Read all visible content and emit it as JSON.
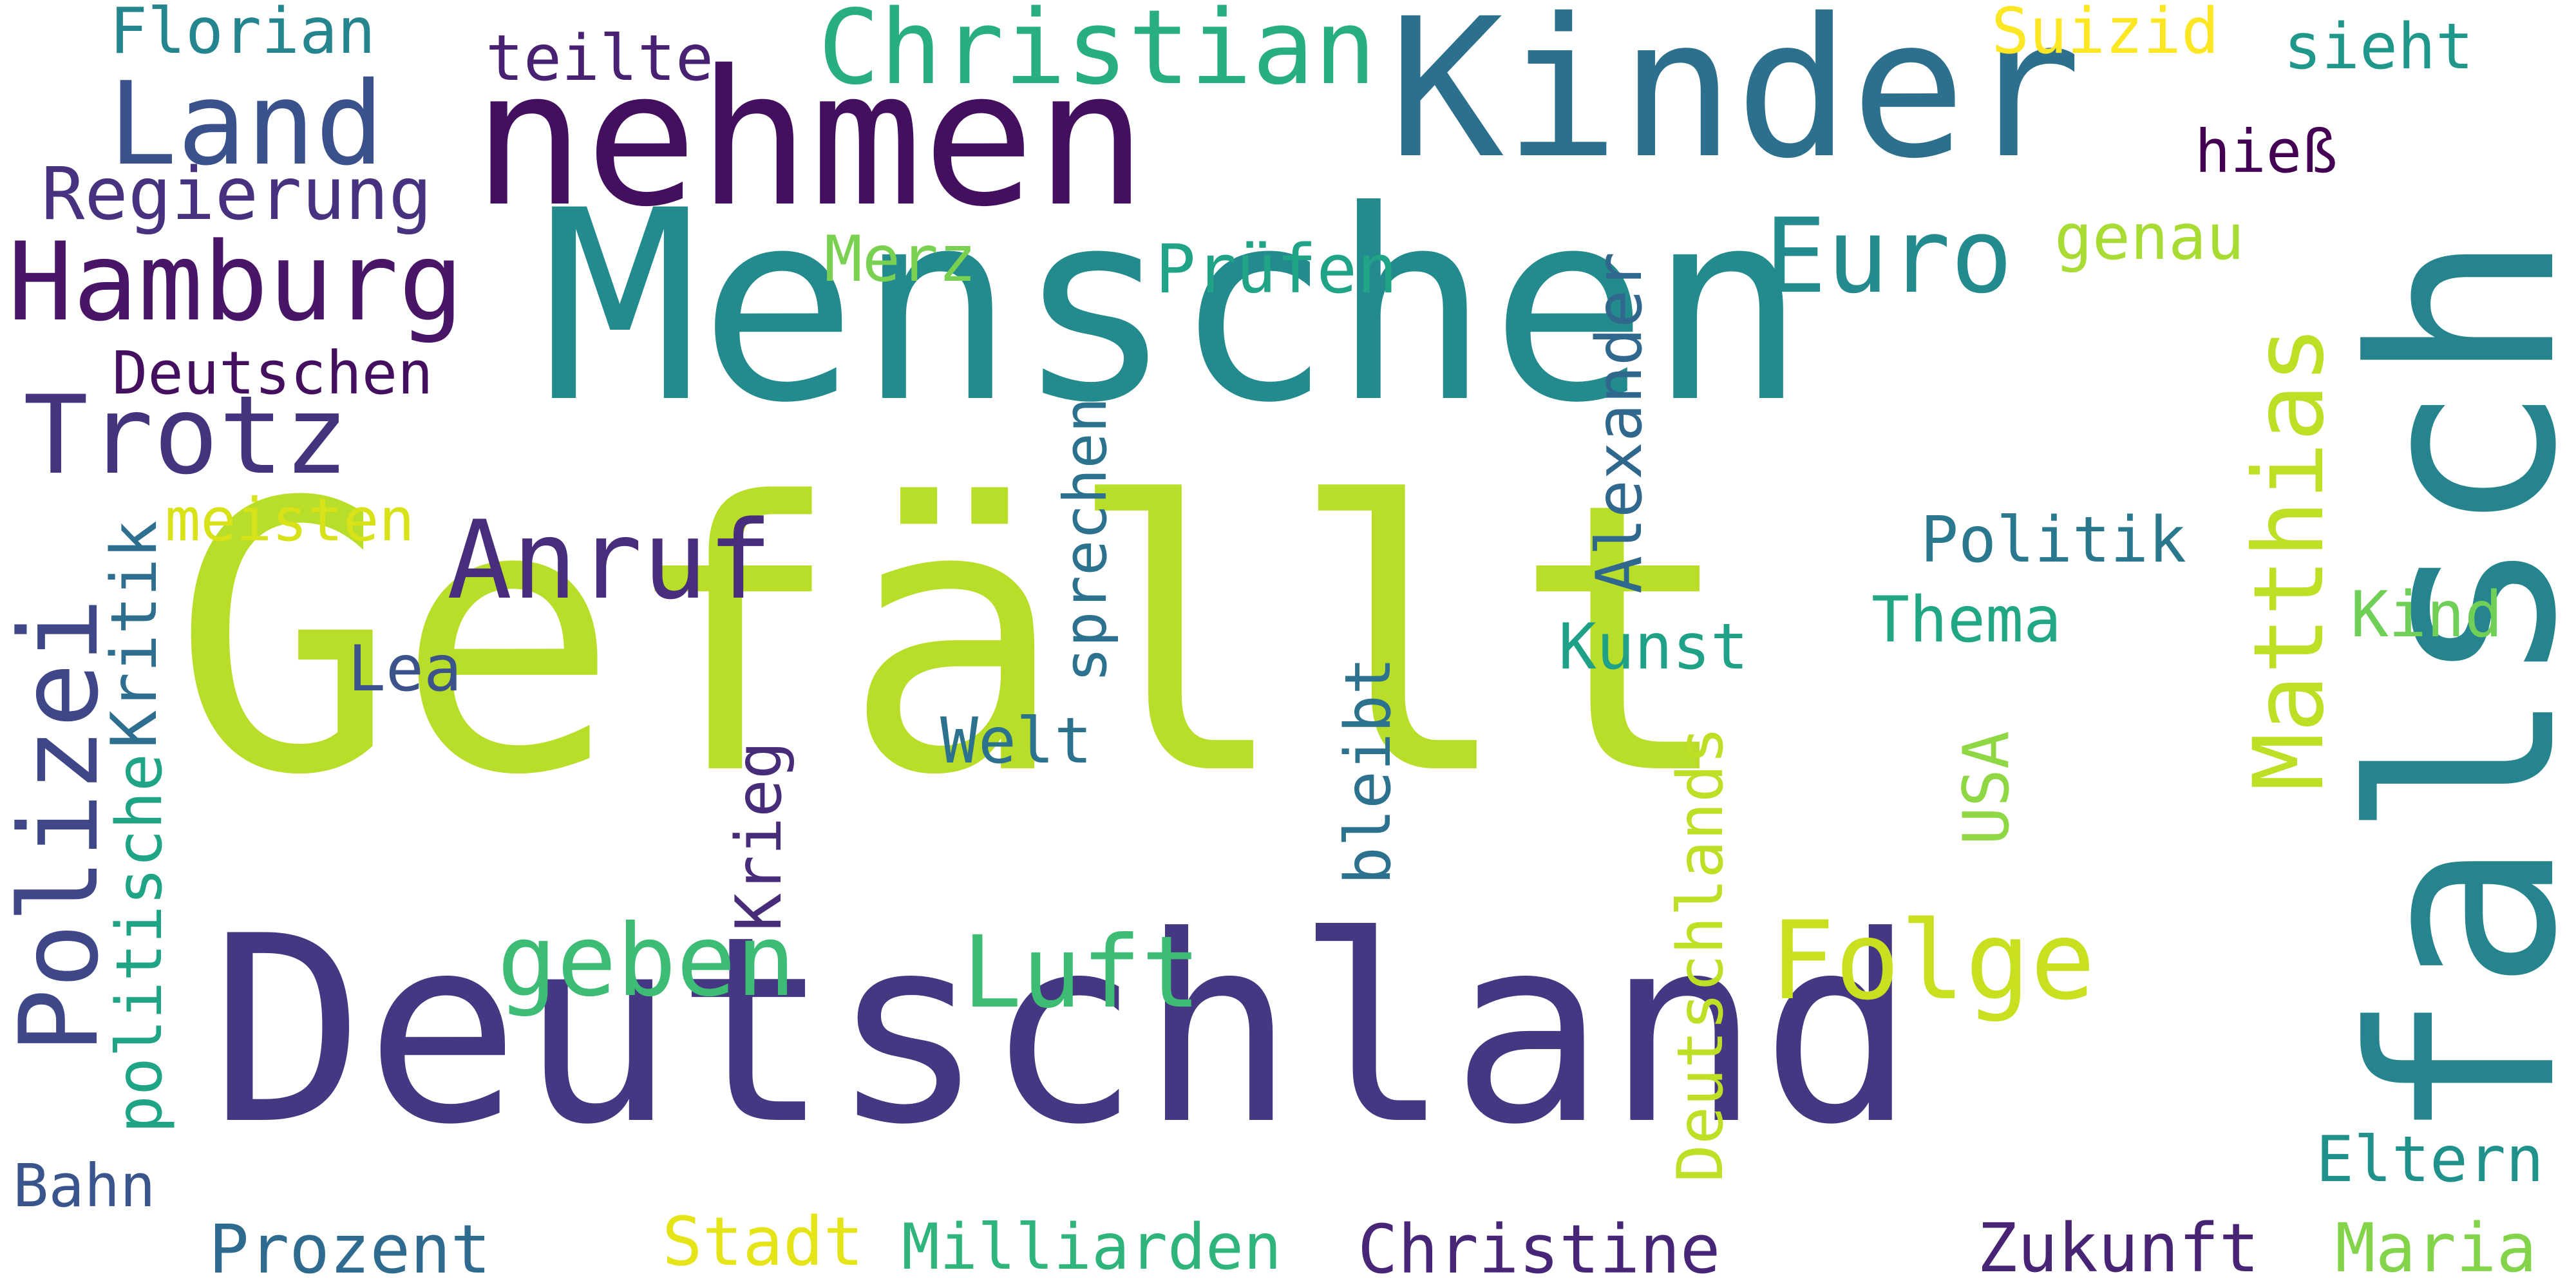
{
  "words": [
    {
      "text": "Gefällt",
      "color": "#b8de29"
    },
    {
      "text": "Menschen",
      "color": "#238a8d"
    },
    {
      "text": "Deutschland",
      "color": "#453781"
    },
    {
      "text": "falsch",
      "color": "#25848e"
    },
    {
      "text": "Kinder",
      "color": "#2d708e"
    },
    {
      "text": "nehmen",
      "color": "#440f5e"
    },
    {
      "text": "Land",
      "color": "#3b518b"
    },
    {
      "text": "Hamburg",
      "color": "#481567"
    },
    {
      "text": "Trotz",
      "color": "#46337e"
    },
    {
      "text": "Christian",
      "color": "#29af7f"
    },
    {
      "text": "Euro",
      "color": "#238a8d"
    },
    {
      "text": "Anruf",
      "color": "#472d7b"
    },
    {
      "text": "Polizei",
      "color": "#3f4788"
    },
    {
      "text": "Matthias",
      "color": "#bddf26"
    },
    {
      "text": "geben",
      "color": "#3cbc75"
    },
    {
      "text": "Folge",
      "color": "#c8e020"
    },
    {
      "text": "Luft",
      "color": "#3dbc74"
    },
    {
      "text": "Florian",
      "color": "#25858e"
    },
    {
      "text": "teilte",
      "color": "#482173"
    },
    {
      "text": "Suizid",
      "color": "#fde725"
    },
    {
      "text": "sieht",
      "color": "#1f988b"
    },
    {
      "text": "hieß",
      "color": "#440154"
    },
    {
      "text": "Regierung",
      "color": "#46327e"
    },
    {
      "text": "Merz",
      "color": "#7ad151"
    },
    {
      "text": "Prüfen",
      "color": "#20a386"
    },
    {
      "text": "genau",
      "color": "#a8db34"
    },
    {
      "text": "Deutschen",
      "color": "#440f5e"
    },
    {
      "text": "Alexander",
      "color": "#30678d"
    },
    {
      "text": "sprechen",
      "color": "#2c728e"
    },
    {
      "text": "meisten",
      "color": "#d8e219"
    },
    {
      "text": "Politik",
      "color": "#2a788e"
    },
    {
      "text": "Thema",
      "color": "#22a785"
    },
    {
      "text": "Kind",
      "color": "#70cf57"
    },
    {
      "text": "Kunst",
      "color": "#1fa187"
    },
    {
      "text": "Kritik",
      "color": "#2e6e8e"
    },
    {
      "text": "Lea",
      "color": "#3b528b"
    },
    {
      "text": "politische",
      "color": "#20a486"
    },
    {
      "text": "Krieg",
      "color": "#472c7a"
    },
    {
      "text": "Welt",
      "color": "#2c728e"
    },
    {
      "text": "bleibt",
      "color": "#2c718e"
    },
    {
      "text": "USA",
      "color": "#8fd744"
    },
    {
      "text": "Deutschlands",
      "color": "#bddf26"
    },
    {
      "text": "Eltern",
      "color": "#21918c"
    },
    {
      "text": "Bahn",
      "color": "#3a548c"
    },
    {
      "text": "Prozent",
      "color": "#2f6b8e"
    },
    {
      "text": "Stadt",
      "color": "#e5e419"
    },
    {
      "text": "Milliarden",
      "color": "#2fb47c"
    },
    {
      "text": "Christine",
      "color": "#482677"
    },
    {
      "text": "Zukunft",
      "color": "#482475"
    },
    {
      "text": "Maria",
      "color": "#84d44b"
    }
  ]
}
